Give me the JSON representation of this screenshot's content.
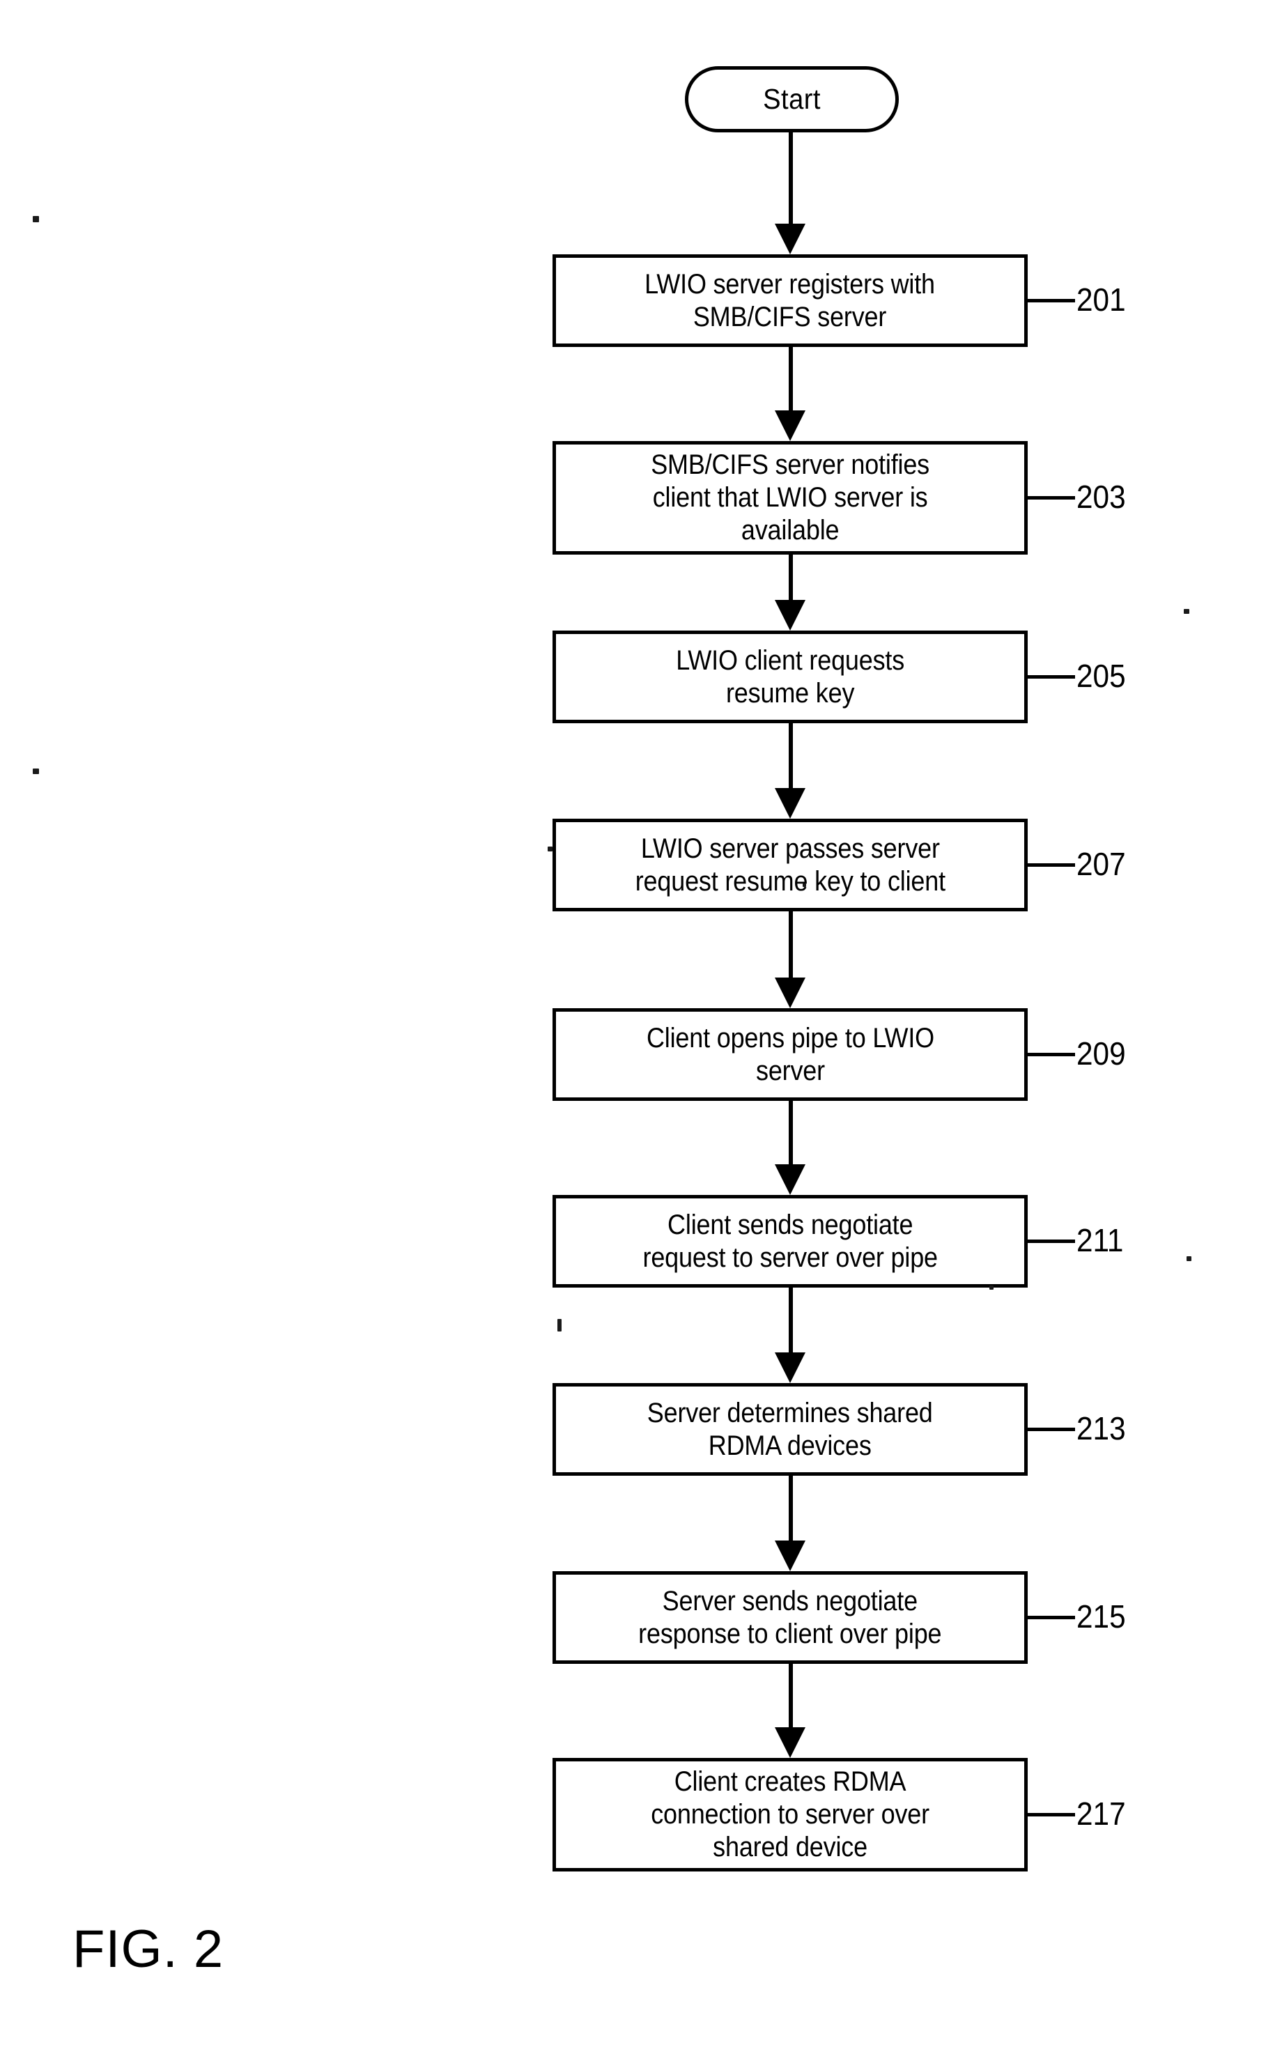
{
  "figure": {
    "caption": "FIG. 2",
    "terminal": {
      "label": "Start",
      "shape": "stadium"
    },
    "steps": [
      {
        "ref": "201",
        "text": "LWIO server registers with\nSMB/CIFS server",
        "lines": 2
      },
      {
        "ref": "203",
        "text": "SMB/CIFS server notifies\nclient that LWIO server is\navailable",
        "lines": 3
      },
      {
        "ref": "205",
        "text": "LWIO client requests\nresume key",
        "lines": 2
      },
      {
        "ref": "207",
        "text": "LWIO server passes server\nrequest resume key to client",
        "lines": 2
      },
      {
        "ref": "209",
        "text": "Client opens pipe to LWIO\nserver",
        "lines": 2
      },
      {
        "ref": "211",
        "text": "Client sends negotiate\nrequest to server over pipe",
        "lines": 2
      },
      {
        "ref": "213",
        "text": "Server determines shared\nRDMA devices",
        "lines": 2
      },
      {
        "ref": "215",
        "text": "Server sends negotiate\nresponse to client over pipe",
        "lines": 2
      },
      {
        "ref": "217",
        "text": "Client creates RDMA\nconnection to server over\nshared device",
        "lines": 3
      }
    ],
    "colors": {
      "ink": "#000000",
      "paper": "#ffffff"
    }
  }
}
